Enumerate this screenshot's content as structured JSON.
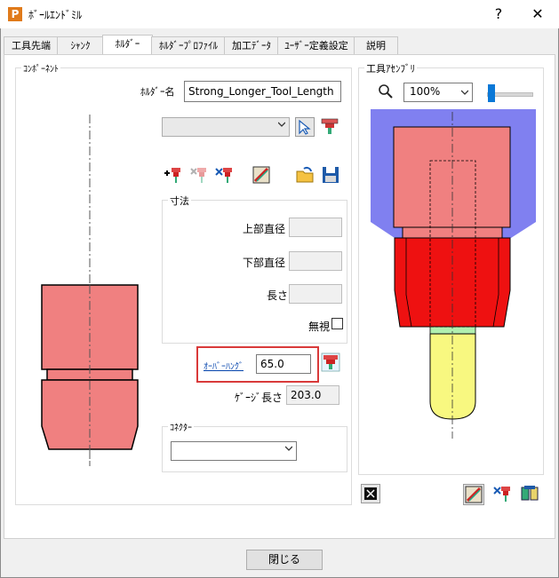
{
  "window": {
    "title": "ﾎﾞｰﾙｴﾝﾄﾞﾐﾙ",
    "app_icon_letter": "P",
    "help_glyph": "?",
    "close_glyph": "✕"
  },
  "tabs": [
    {
      "label": "工具先端"
    },
    {
      "label": "ｼｬﾝｸ"
    },
    {
      "label": "ﾎﾙﾀﾞｰ",
      "active": true
    },
    {
      "label": "ﾎﾙﾀﾞｰﾌﾟﾛﾌｧｲﾙ"
    },
    {
      "label": "加工ﾃﾞｰﾀ"
    },
    {
      "label": "ﾕｰｻﾞｰ定義設定"
    },
    {
      "label": "説明"
    }
  ],
  "component": {
    "group_label": "ｺﾝﾎﾟｰﾈﾝﾄ",
    "holder_name_label": "ﾎﾙﾀﾞｰ名",
    "holder_name_value": "Strong_Longer_Tool_Length",
    "library_select_value": ""
  },
  "dimensions": {
    "group_label": "寸法",
    "upper_dia_label": "上部直径",
    "upper_dia_value": "",
    "lower_dia_label": "下部直径",
    "lower_dia_value": "",
    "length_label": "長さ",
    "length_value": "",
    "ignore_label": "無視"
  },
  "overhang": {
    "label": "ｵｰﾊﾞｰﾊﾝｸﾞ",
    "value": "65.0",
    "highlight_color": "#d93a3a"
  },
  "gauge": {
    "label": "ｹﾞｰｼﾞ長さ",
    "value": "203.0"
  },
  "connector": {
    "group_label": "ｺﾈｸﾀｰ",
    "select_value": ""
  },
  "assembly": {
    "group_label": "工具ｱｾﾝﾌﾞﾘ",
    "zoom_value": "100%",
    "zoom_slider": 0.0
  },
  "colors": {
    "holder_pink": "#f08080",
    "holder_red": "#ee1111",
    "holder_blue": "#8080f0",
    "shank_green": "#b0f0b0",
    "tool_yellow": "#f8f880"
  },
  "icons": [
    "pick-icon",
    "add-holder-icon",
    "remove-holder-icon",
    "edit-holder-icon",
    "holder-db-icon",
    "open-folder-icon",
    "save-icon"
  ],
  "footer": {
    "close_label": "閉じる"
  }
}
